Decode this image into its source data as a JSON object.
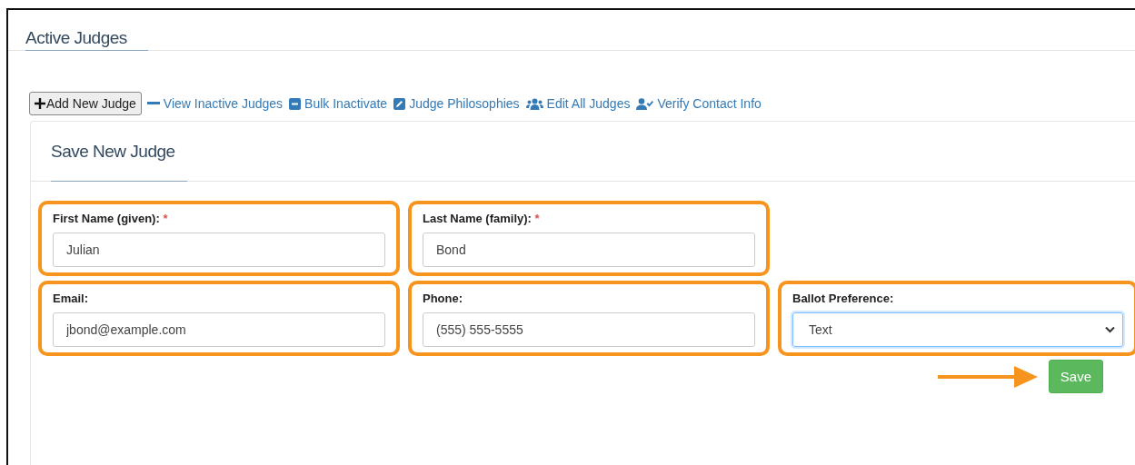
{
  "page_title": "Active Judges",
  "toolbar": {
    "add_button": "Add New Judge",
    "links": [
      {
        "label": "View Inactive Judges"
      },
      {
        "label": "Bulk Inactivate"
      },
      {
        "label": "Judge Philosophies"
      },
      {
        "label": "Edit All Judges"
      },
      {
        "label": "Verify Contact Info"
      }
    ]
  },
  "form": {
    "title": "Save New Judge",
    "rows": [
      [
        {
          "label": "First Name (given):",
          "required_mark": "*",
          "kind": "input",
          "value": "Julian",
          "highlighted": true
        },
        {
          "label": "Last Name (family):",
          "required_mark": "*",
          "kind": "input",
          "value": "Bond",
          "highlighted": true
        }
      ],
      [
        {
          "label": "Email:",
          "kind": "input",
          "value": "jbond@example.com",
          "highlighted": true
        },
        {
          "label": "Phone:",
          "kind": "input",
          "value": "(555) 555-5555",
          "highlighted": true
        },
        {
          "label": "Ballot Preference:",
          "kind": "select",
          "value": "Text",
          "highlighted": true,
          "focused": true
        }
      ]
    ],
    "save_button": "Save",
    "save_arrow": true
  }
}
